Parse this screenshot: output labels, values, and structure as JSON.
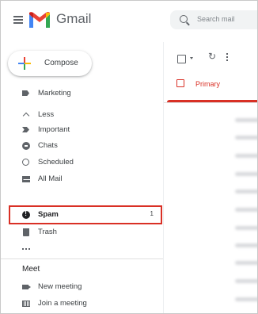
{
  "header": {
    "brand": "Gmail",
    "search_placeholder": "Search mail"
  },
  "compose": {
    "label": "Compose"
  },
  "nav": [
    {
      "label": "Marketing",
      "icon": "label-icon"
    },
    {
      "label": "Less",
      "icon": "chevron-up-icon"
    },
    {
      "label": "Important",
      "icon": "important-icon"
    },
    {
      "label": "Chats",
      "icon": "chat-icon"
    },
    {
      "label": "Scheduled",
      "icon": "scheduled-icon"
    },
    {
      "label": "All Mail",
      "icon": "mail-icon"
    },
    {
      "label": "Spam",
      "count": "1",
      "icon": "spam-icon"
    },
    {
      "label": "Trash",
      "icon": "trash-icon"
    },
    {
      "label": "",
      "icon": "more-icon"
    }
  ],
  "meet": {
    "title": "Meet",
    "items": [
      {
        "label": "New meeting",
        "icon": "video-icon"
      },
      {
        "label": "Join a meeting",
        "icon": "keyboard-icon"
      }
    ]
  },
  "tabs": {
    "primary": "Primary"
  },
  "colors": {
    "accent_red": "#d93025",
    "highlight_box": "#d93025"
  }
}
